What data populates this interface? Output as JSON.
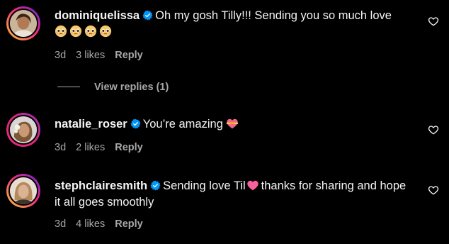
{
  "comments": [
    {
      "username": "dominiquelissa",
      "verified": true,
      "text_part1": "Oh my gosh Tilly!!! Sending you so much love",
      "emojis": [
        "pleading-face-emoji",
        "pleading-face-emoji",
        "pleading-face-emoji",
        "pleading-face-emoji"
      ],
      "time": "3d",
      "likes": "3 likes",
      "reply": "Reply",
      "view_replies": "View replies (1)"
    },
    {
      "username": "natalie_roser",
      "verified": true,
      "text_part1": "You’re amazing",
      "emojis": [
        "heart-with-ribbon-emoji"
      ],
      "time": "3d",
      "likes": "2 likes",
      "reply": "Reply"
    },
    {
      "username": "stephclairesmith",
      "verified": true,
      "text_part1": "Sending love Til",
      "emoji_mid": "pink-heart-emoji",
      "text_part2": "thanks for sharing and hope it all goes smoothly",
      "time": "3d",
      "likes": "4 likes",
      "reply": "Reply"
    }
  ],
  "colors": {
    "background": "#000000",
    "text": "#f5f5f5",
    "secondary": "#a8a8a8",
    "verified_blue": "#0095f6",
    "story_ring_start": "#f9ce34",
    "story_ring_mid": "#ee2a7b",
    "story_ring_end": "#6228d7"
  }
}
